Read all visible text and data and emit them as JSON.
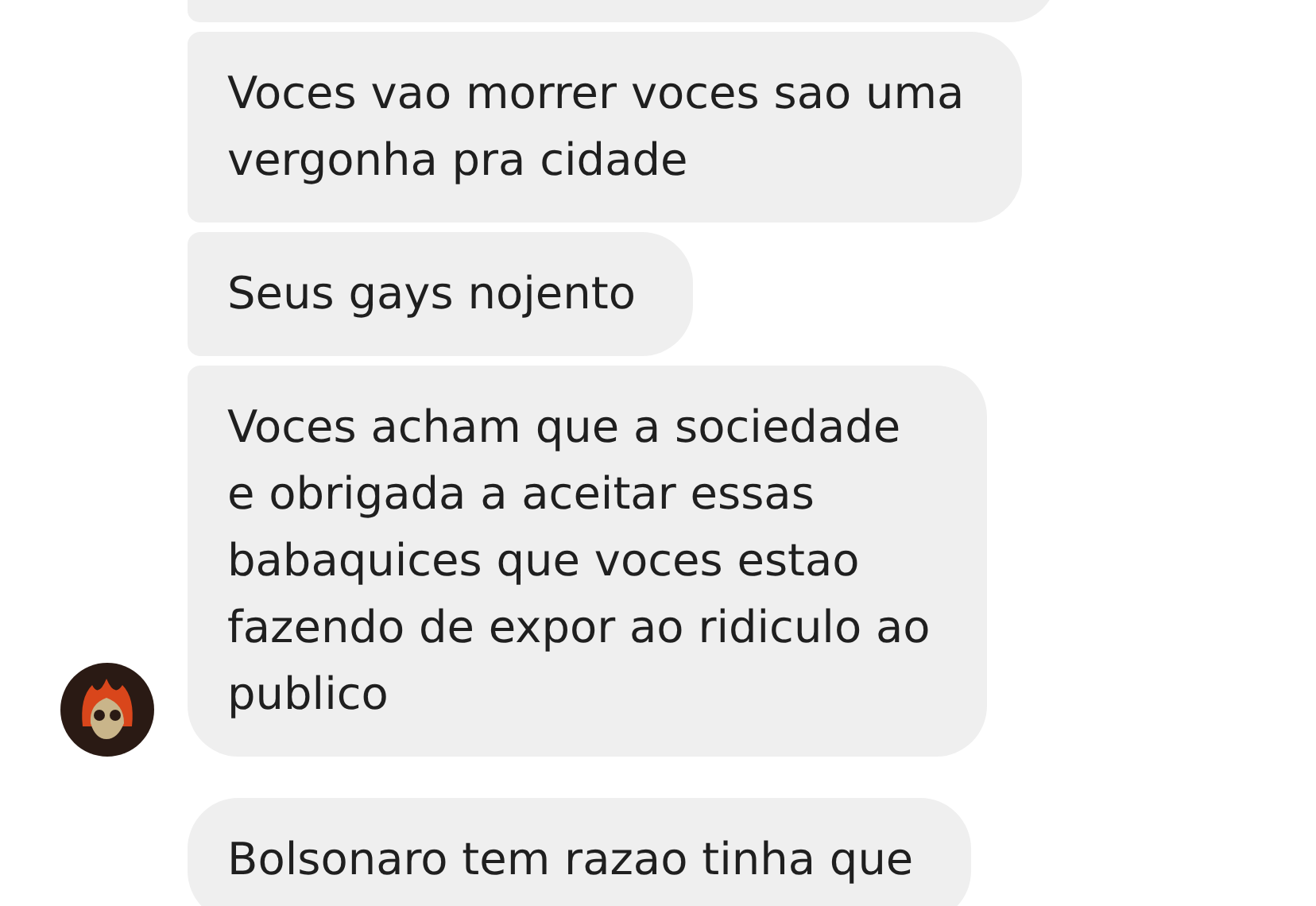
{
  "messages": [
    {
      "text": "Voces vao morrer voces sao uma\nvergonha pra cidade",
      "show_avatar": false
    },
    {
      "text": "Seus gays nojento",
      "show_avatar": false
    },
    {
      "text": "Voces acham que a sociedade\ne obrigada a aceitar essas\nbabaquices que voces estao\nfazendo de expor ao ridiculo ao\npublico",
      "show_avatar": true
    },
    {
      "text": "Bolsonaro tem razao tinha que",
      "show_avatar": false,
      "gap_before": true
    }
  ]
}
